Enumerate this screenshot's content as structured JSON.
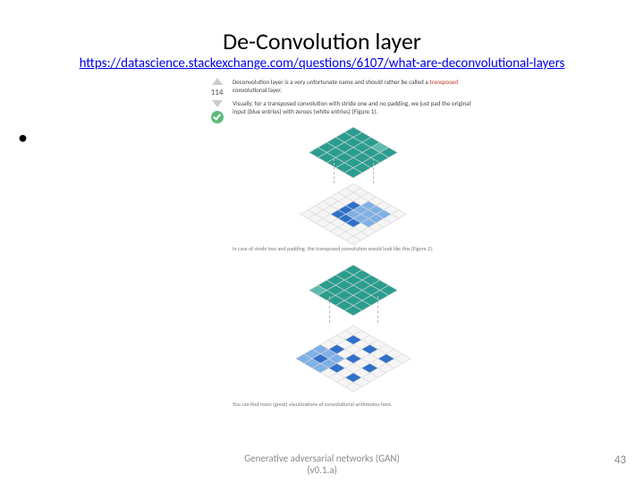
{
  "title": "De-Convolution layer",
  "link_text": "https://datascience.stackexchange.com/questions/6107/what-are-deconvolutional-layers",
  "footer": {
    "line1": "Generative adversarial networks (GAN)",
    "line2": "(v0.1.a)"
  },
  "slide_number": "43",
  "se": {
    "vote_count": "114",
    "p1_a": "Deconvolution layer is a very unfortunate name and should rather be called a ",
    "p1_term": "transposed",
    "p1_b": " convolutional layer.",
    "p2": "Visually, for a transposed convolution with stride one and no padding, we just pad the original input (blue entries) with zeroes (white entries) (Figure 1).",
    "cap2": "In case of stride two and padding, the transposed convolution would look like this (Figure 2).",
    "p3": "You can find more (great) visualizations of convolutional arithmetics here."
  }
}
